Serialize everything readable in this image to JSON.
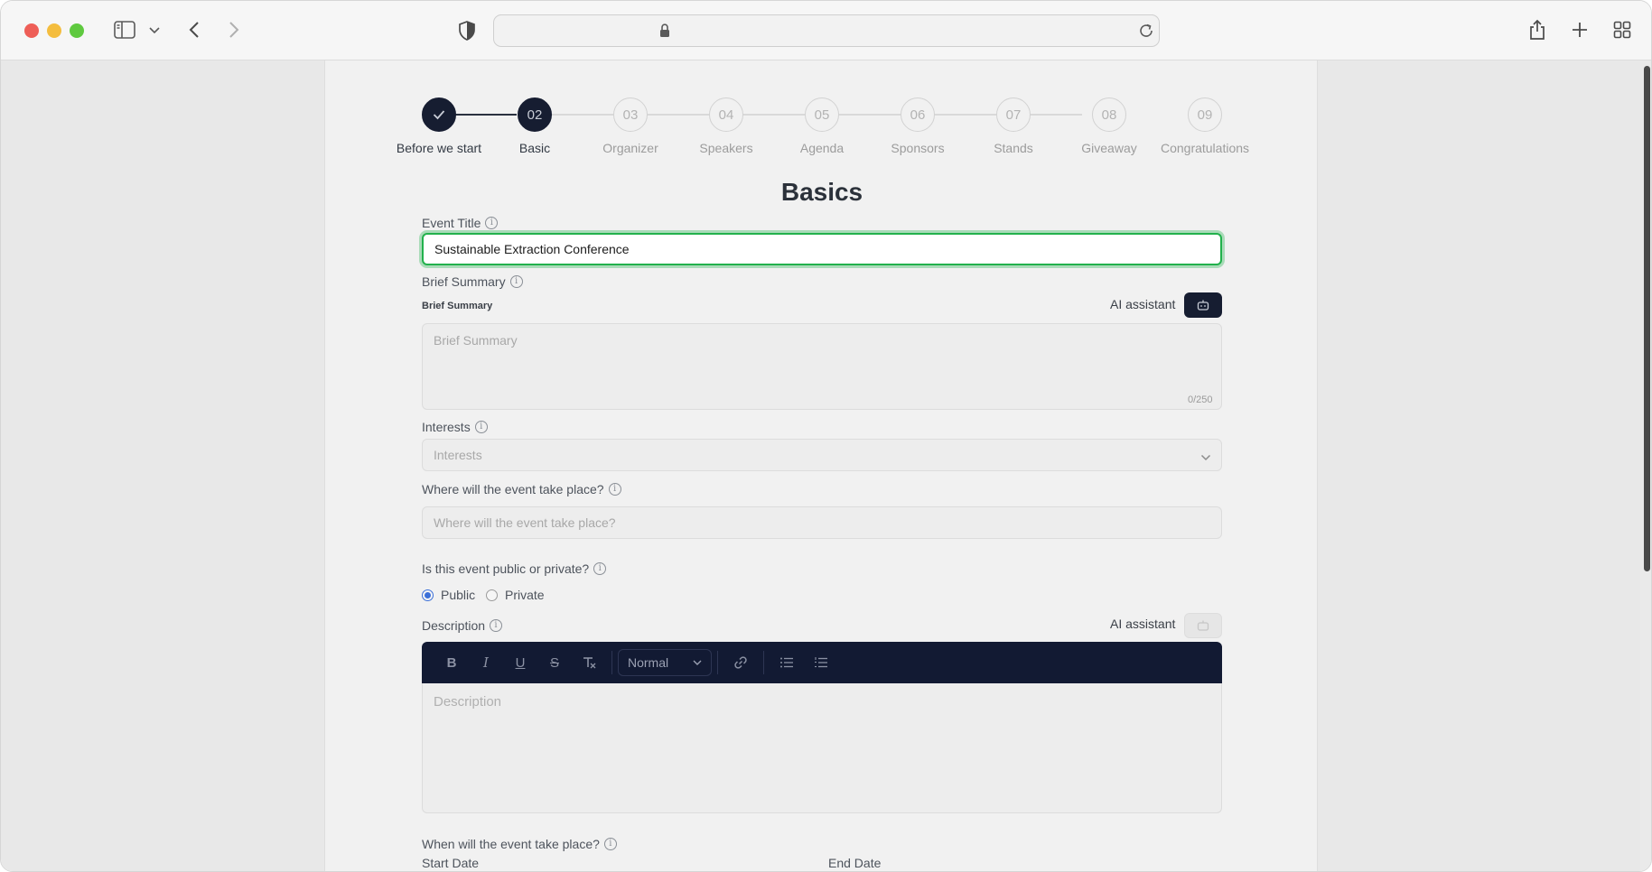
{
  "browser": {
    "address_lock_icon": "lock-icon",
    "buttons": [
      "sidebar-toggle",
      "back",
      "forward",
      "privacy-shield",
      "reload",
      "share",
      "new-tab",
      "tab-overview"
    ]
  },
  "stepper": {
    "steps": [
      {
        "number": "",
        "label": "Before we start",
        "state": "done"
      },
      {
        "number": "02",
        "label": "Basic",
        "state": "active"
      },
      {
        "number": "03",
        "label": "Organizer",
        "state": "upcoming"
      },
      {
        "number": "04",
        "label": "Speakers",
        "state": "upcoming"
      },
      {
        "number": "05",
        "label": "Agenda",
        "state": "upcoming"
      },
      {
        "number": "06",
        "label": "Sponsors",
        "state": "upcoming"
      },
      {
        "number": "07",
        "label": "Stands",
        "state": "upcoming"
      },
      {
        "number": "08",
        "label": "Giveaway",
        "state": "upcoming"
      },
      {
        "number": "09",
        "label": "Congratulations",
        "state": "upcoming"
      }
    ]
  },
  "form": {
    "heading": "Basics",
    "event_title": {
      "label": "Event Title",
      "value": "Sustainable Extraction Conference"
    },
    "brief_summary": {
      "label": "Brief Summary",
      "sublabel": "Brief Summary",
      "ai_label": "AI assistant",
      "placeholder": "Brief Summary",
      "counter": "0/250"
    },
    "interests": {
      "label": "Interests",
      "placeholder": "Interests"
    },
    "location": {
      "label": "Where will the event take place?",
      "placeholder": "Where will the event take place?"
    },
    "visibility": {
      "label": "Is this event public or private?",
      "options": [
        {
          "label": "Public",
          "checked": true
        },
        {
          "label": "Private",
          "checked": false
        }
      ]
    },
    "description": {
      "label": "Description",
      "ai_label": "AI assistant",
      "toolbar": {
        "format_select": "Normal",
        "buttons": [
          "bold",
          "italic",
          "underline",
          "strikethrough",
          "clear-format",
          "link",
          "bullet-list",
          "ordered-list"
        ]
      },
      "placeholder": "Description"
    },
    "dates": {
      "label": "When will the event take place?",
      "start_label": "Start Date",
      "end_label": "End Date"
    }
  },
  "colors": {
    "accent_dark": "#161d31",
    "focus_ring": "#22b14c",
    "radio_checked": "#3b6fd8"
  }
}
